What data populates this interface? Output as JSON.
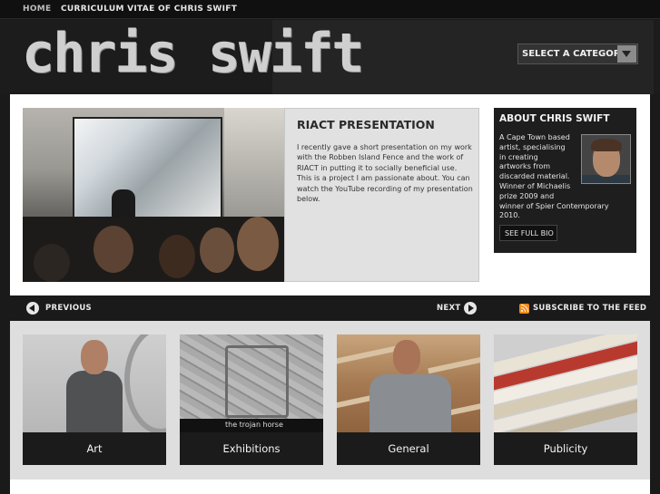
{
  "nav": {
    "home": "HOME",
    "cv": "CURRICULUM VITAE OF CHRIS SWIFT"
  },
  "header": {
    "logo": "chris swift",
    "category_select": "SELECT A CATEGORY"
  },
  "feature": {
    "title": "RIACT PRESENTATION",
    "text": "I recently gave a short presentation on my work with the Robben Island Fence and the work of RIACT in putting it to socially beneficial use. This is a project I am passionate about. You can watch the YouTube recording of my presentation below."
  },
  "about": {
    "title": "ABOUT CHRIS SWIFT",
    "lines": [
      "A Cape Town based",
      "artist, specialising",
      "in creating",
      "artworks from",
      "discarded material.",
      "Winner of Michaelis",
      "prize 2009 and",
      "winner of Spier Contemporary",
      "2010."
    ],
    "bio_button": "SEE FULL BIO"
  },
  "pager": {
    "previous": "PREVIOUS",
    "next": "NEXT",
    "subscribe": "SUBSCRIBE TO THE FEED"
  },
  "categories": [
    {
      "label": "Art"
    },
    {
      "label": "Exhibitions",
      "image_caption": "the trojan horse"
    },
    {
      "label": "General"
    },
    {
      "label": "Publicity"
    }
  ],
  "colors": {
    "page_bg": "#1a1a1a",
    "panel": "#ffffff",
    "text_box": "#e1e1e1",
    "rss": "#f28a1a"
  }
}
